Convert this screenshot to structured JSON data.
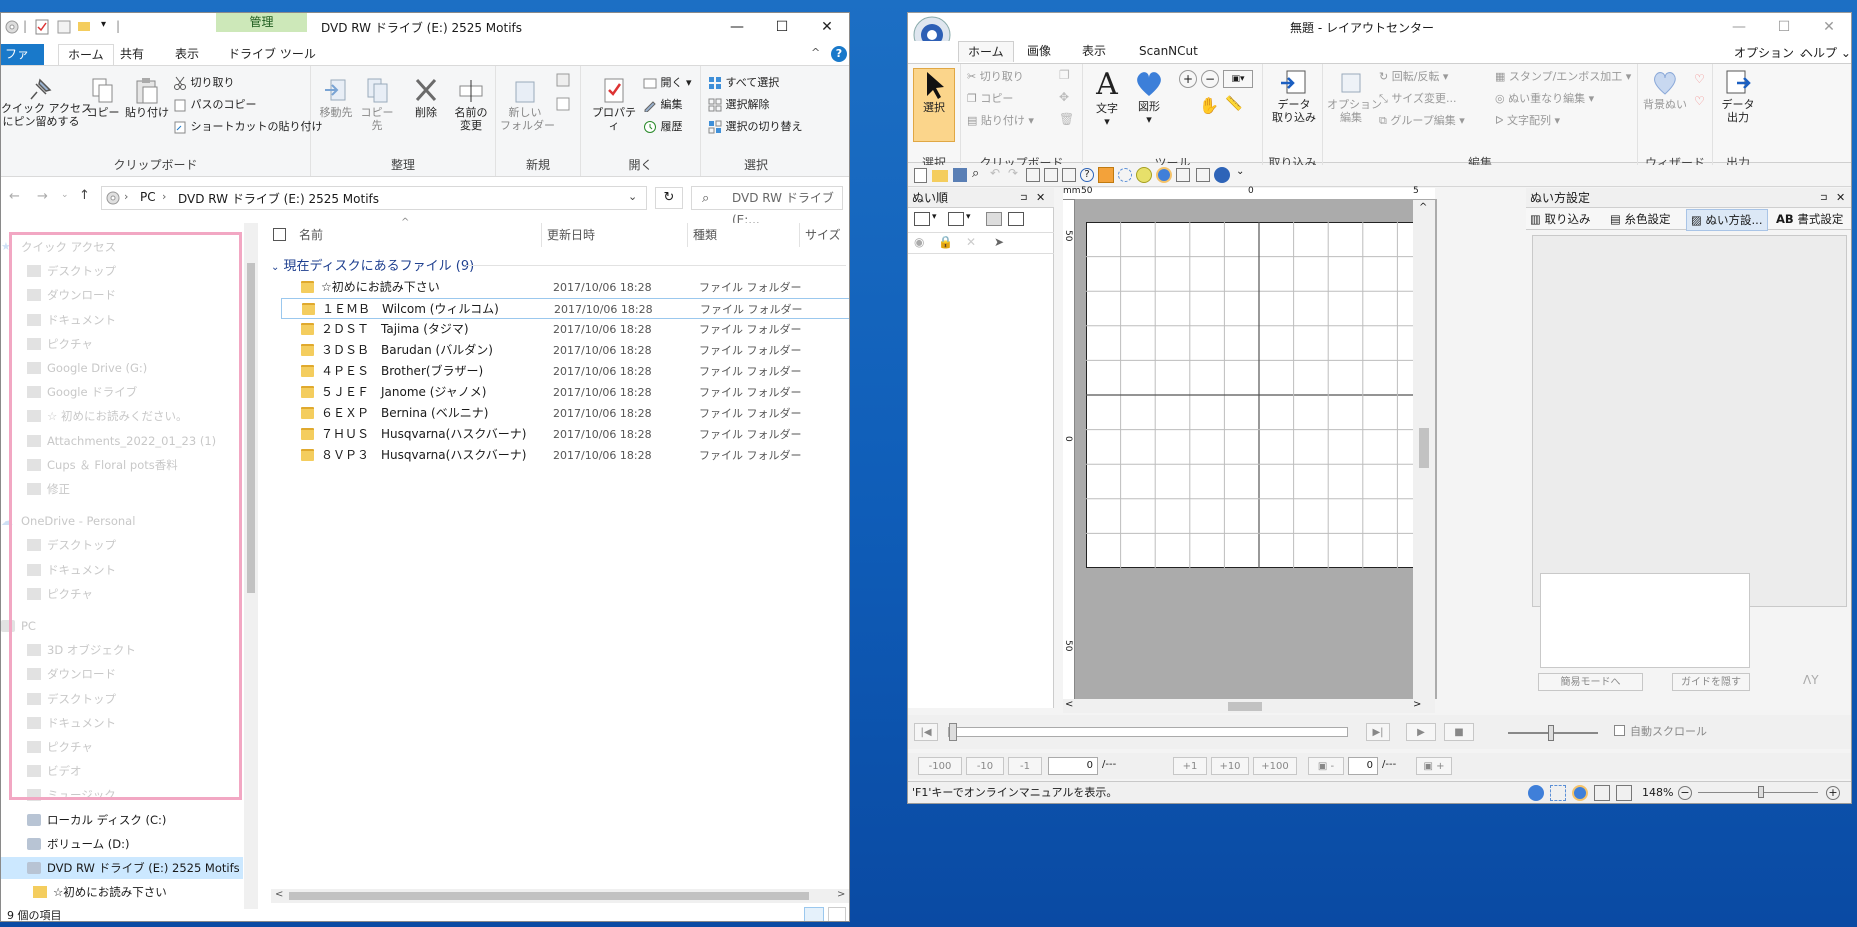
{
  "explorer": {
    "title": "DVD RW ドライブ (E:) 2525 Motifs",
    "context_tab": "管理",
    "tabs": [
      "ファイル",
      "ホーム",
      "共有",
      "表示",
      "ドライブ ツール"
    ],
    "ribbon": {
      "pin": "クイック アクセス\nにピン留めする",
      "copy": "コピー",
      "paste": "貼り付け",
      "cut": "切り取り",
      "copy_path": "パスのコピー",
      "paste_shortcut": "ショートカットの貼り付け",
      "clipboard": "クリップボード",
      "move_to": "移動先",
      "copy_to": "コピー先",
      "delete": "削除",
      "rename": "名前の\n変更",
      "organize": "整理",
      "new_folder": "新しい\nフォルダー",
      "new": "新規",
      "properties": "プロパティ",
      "open": "開く",
      "open_group": "開く",
      "edit": "編集",
      "history": "履歴",
      "select_all": "すべて選択",
      "select_none": "選択解除",
      "invert": "選択の切り替え",
      "select": "選択"
    },
    "address": {
      "pc": "PC",
      "sep": "›",
      "path": "DVD RW ドライブ (E:) 2525 Motifs",
      "search_placeholder": "DVD RW ドライブ (E:..."
    },
    "nav": {
      "quick_access": "クイック アクセス",
      "items_faded": [
        "デスクトップ",
        "ダウンロード",
        "ドキュメント",
        "ピクチャ",
        "Google Drive (G:)",
        "Google ドライブ",
        "☆ 初めにお読みください。",
        "Attachments_2022_01_23 (1)",
        "Cups ＆ Floral pots香料",
        "修正"
      ],
      "onedrive": "OneDrive - Personal",
      "onedrive_items": [
        "デスクトップ",
        "ドキュメント",
        "ピクチャ"
      ],
      "pc": "PC",
      "pc_items": [
        "3D オブジェクト",
        "ダウンロード",
        "デスクトップ",
        "ドキュメント",
        "ピクチャ",
        "ビデオ",
        "ミュージック"
      ],
      "drives": [
        "ローカル ディスク (C:)",
        "ボリューム (D:)",
        "DVD RW ドライブ (E:) 2525 Motifs",
        "☆初めにお読み下さい",
        "１ＥＭＢ　Wilcom (ウィルコム)"
      ]
    },
    "columns": [
      "名前",
      "更新日時",
      "種類",
      "サイズ"
    ],
    "group_header": "現在ディスクにあるファイル (9)",
    "files": [
      {
        "name": "☆初めにお読み下さい",
        "date": "2017/10/06 18:28",
        "type": "ファイル フォルダー"
      },
      {
        "name": "１ＥＭＢ　Wilcom (ウィルコム)",
        "date": "2017/10/06 18:28",
        "type": "ファイル フォルダー"
      },
      {
        "name": "２ＤＳＴ　Tajima (タジマ)",
        "date": "2017/10/06 18:28",
        "type": "ファイル フォルダー"
      },
      {
        "name": "３ＤＳＢ　Barudan (バルダン)",
        "date": "2017/10/06 18:28",
        "type": "ファイル フォルダー"
      },
      {
        "name": "４ＰＥＳ　Brother(ブラザー)",
        "date": "2017/10/06 18:28",
        "type": "ファイル フォルダー"
      },
      {
        "name": "５ＪＥＦ　Janome (ジャノメ)",
        "date": "2017/10/06 18:28",
        "type": "ファイル フォルダー"
      },
      {
        "name": "６ＥＸＰ　Bernina (ベルニナ)",
        "date": "2017/10/06 18:28",
        "type": "ファイル フォルダー"
      },
      {
        "name": "７ＨＵＳ　Husqvarna(ハスクバーナ)",
        "date": "2017/10/06 18:28",
        "type": "ファイル フォルダー"
      },
      {
        "name": "８ＶＰ３　Husqvarna(ハスクバーナ)",
        "date": "2017/10/06 18:28",
        "type": "ファイル フォルダー"
      }
    ],
    "status": "9 個の項目"
  },
  "layout_center": {
    "title": "無題 - レイアウトセンター",
    "tabs": [
      "ホーム",
      "画像",
      "表示",
      "ScanNCut"
    ],
    "right_menu": {
      "options": "オプション",
      "help": "ヘルプ",
      "arrow": "⌄"
    },
    "ribbon": {
      "select": "選択",
      "select_group": "選択",
      "cut": "切り取り",
      "copy": "コピー",
      "paste": "貼り付け",
      "clipboard": "クリップボード",
      "text": "文字",
      "shape": "図形",
      "tools": "ツール",
      "import": "データ\n取り込み",
      "import_group": "取り込み",
      "option_edit": "オプション\n編集",
      "rotate": "回転/反転",
      "resize": "サイズ変更...",
      "group_edit": "グループ編集",
      "stamp": "スタンプ/エンボス加工",
      "overlap": "ぬい重なり編集",
      "text_arrange": "文字配列",
      "edit_group": "編集",
      "background": "背景ぬい",
      "wizard": "ウィザード",
      "export": "データ\n出力",
      "export_group": "出力"
    },
    "left_pane": "ぬい順",
    "right_pane": {
      "title": "ぬい方設定",
      "tabs": [
        "取り込み",
        "糸色設定",
        "ぬい方設...",
        "書式設定"
      ],
      "easy_mode": "簡易モードへ",
      "hide_guide": "ガイドを隠す"
    },
    "ruler": {
      "h_left": "50",
      "h_mid": "0",
      "h_right": "5",
      "v_top": "50",
      "v_mid": "0",
      "v_bottom": "50"
    },
    "stitch_buttons": [
      "-100",
      "-10",
      "-1",
      "+1",
      "+10",
      "+100"
    ],
    "stitch_value": "0",
    "stitch_total": "/---",
    "color_value": "0",
    "color_total": "/---",
    "auto_scroll": "自動スクロール",
    "status_text": "'F1'キーでオンラインマニュアルを表示。",
    "zoom": "148%"
  }
}
